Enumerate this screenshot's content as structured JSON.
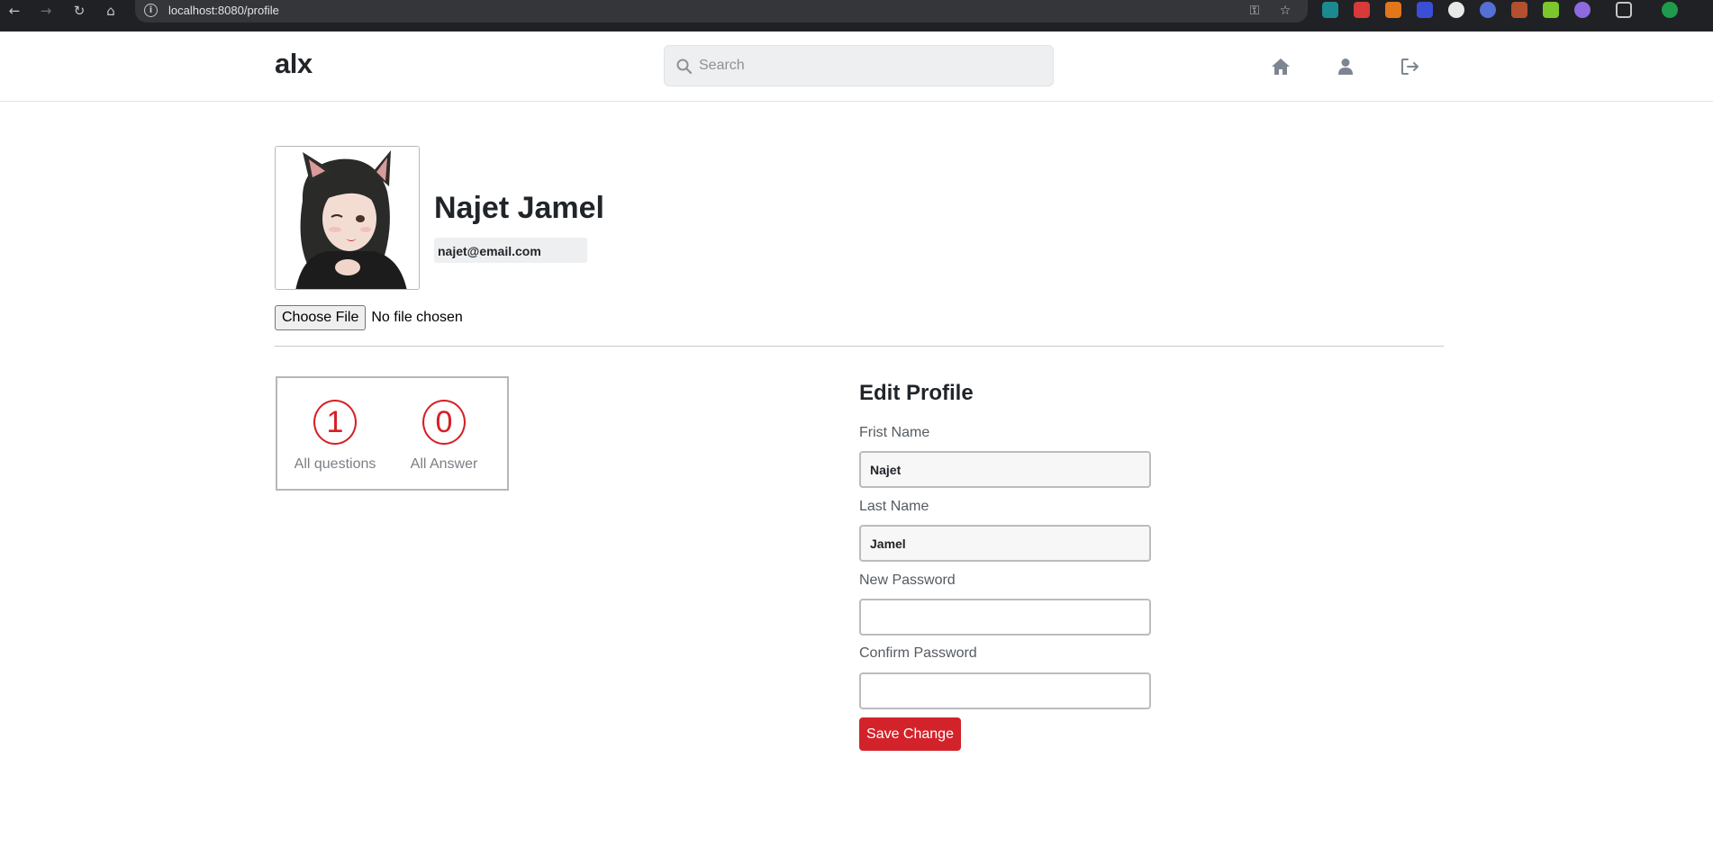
{
  "browser": {
    "url": "localhost:8080/profile",
    "back_icon": "arrow-left-icon",
    "forward_icon": "arrow-right-icon",
    "reload_icon": "reload-icon",
    "home_icon": "home-icon"
  },
  "header": {
    "logo": "alx",
    "search_placeholder": "Search",
    "nav_icons": [
      "home-icon",
      "user-icon",
      "logout-icon"
    ]
  },
  "profile": {
    "name": "Najet Jamel",
    "email": "najet@email.com",
    "file_button": "Choose File",
    "file_status": "No file chosen"
  },
  "stats": [
    {
      "value": "1",
      "label": "All questions"
    },
    {
      "value": "0",
      "label": "All Answer"
    }
  ],
  "edit_form": {
    "title": "Edit Profile",
    "first_name_label": "Frist Name",
    "first_name_value": "Najet",
    "last_name_label": "Last Name",
    "last_name_value": "Jamel",
    "new_password_label": "New Password",
    "confirm_password_label": "Confirm Password",
    "save_label": "Save Change"
  },
  "colors": {
    "accent": "#d3232a",
    "chrome_bg": "#202124",
    "icon_gray": "#7d8590"
  }
}
